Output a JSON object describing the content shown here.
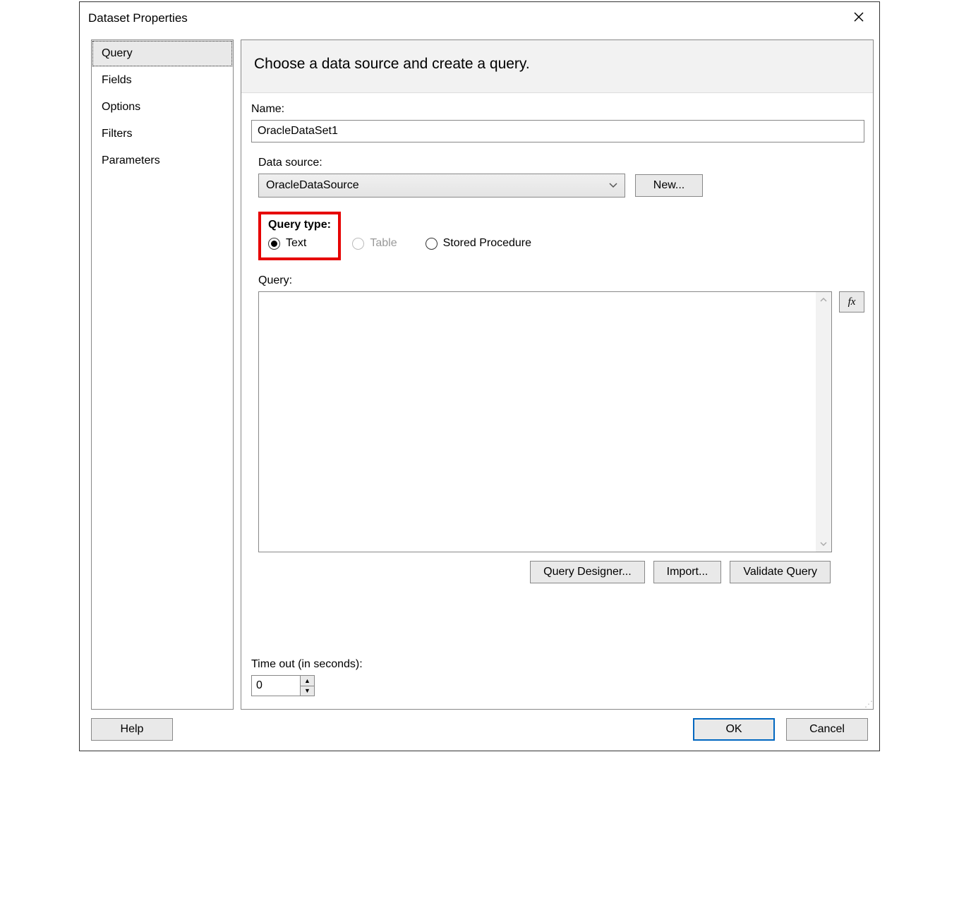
{
  "dialog": {
    "title": "Dataset Properties"
  },
  "nav": {
    "items": [
      {
        "label": "Query",
        "selected": true
      },
      {
        "label": "Fields"
      },
      {
        "label": "Options"
      },
      {
        "label": "Filters"
      },
      {
        "label": "Parameters"
      }
    ]
  },
  "header": {
    "text": "Choose a data source and create a query."
  },
  "name": {
    "label": "Name:",
    "value": "OracleDataSet1"
  },
  "datasource": {
    "label": "Data source:",
    "selected": "OracleDataSource",
    "new_button": "New..."
  },
  "querytype": {
    "label": "Query type:",
    "options": {
      "text": "Text",
      "table": "Table",
      "stored": "Stored Procedure"
    }
  },
  "query": {
    "label": "Query:",
    "value": "",
    "fx_label": "fx",
    "buttons": {
      "designer": "Query Designer...",
      "import": "Import...",
      "validate": "Validate Query"
    }
  },
  "timeout": {
    "label": "Time out (in seconds):",
    "value": "0"
  },
  "footer": {
    "help": "Help",
    "ok": "OK",
    "cancel": "Cancel"
  }
}
